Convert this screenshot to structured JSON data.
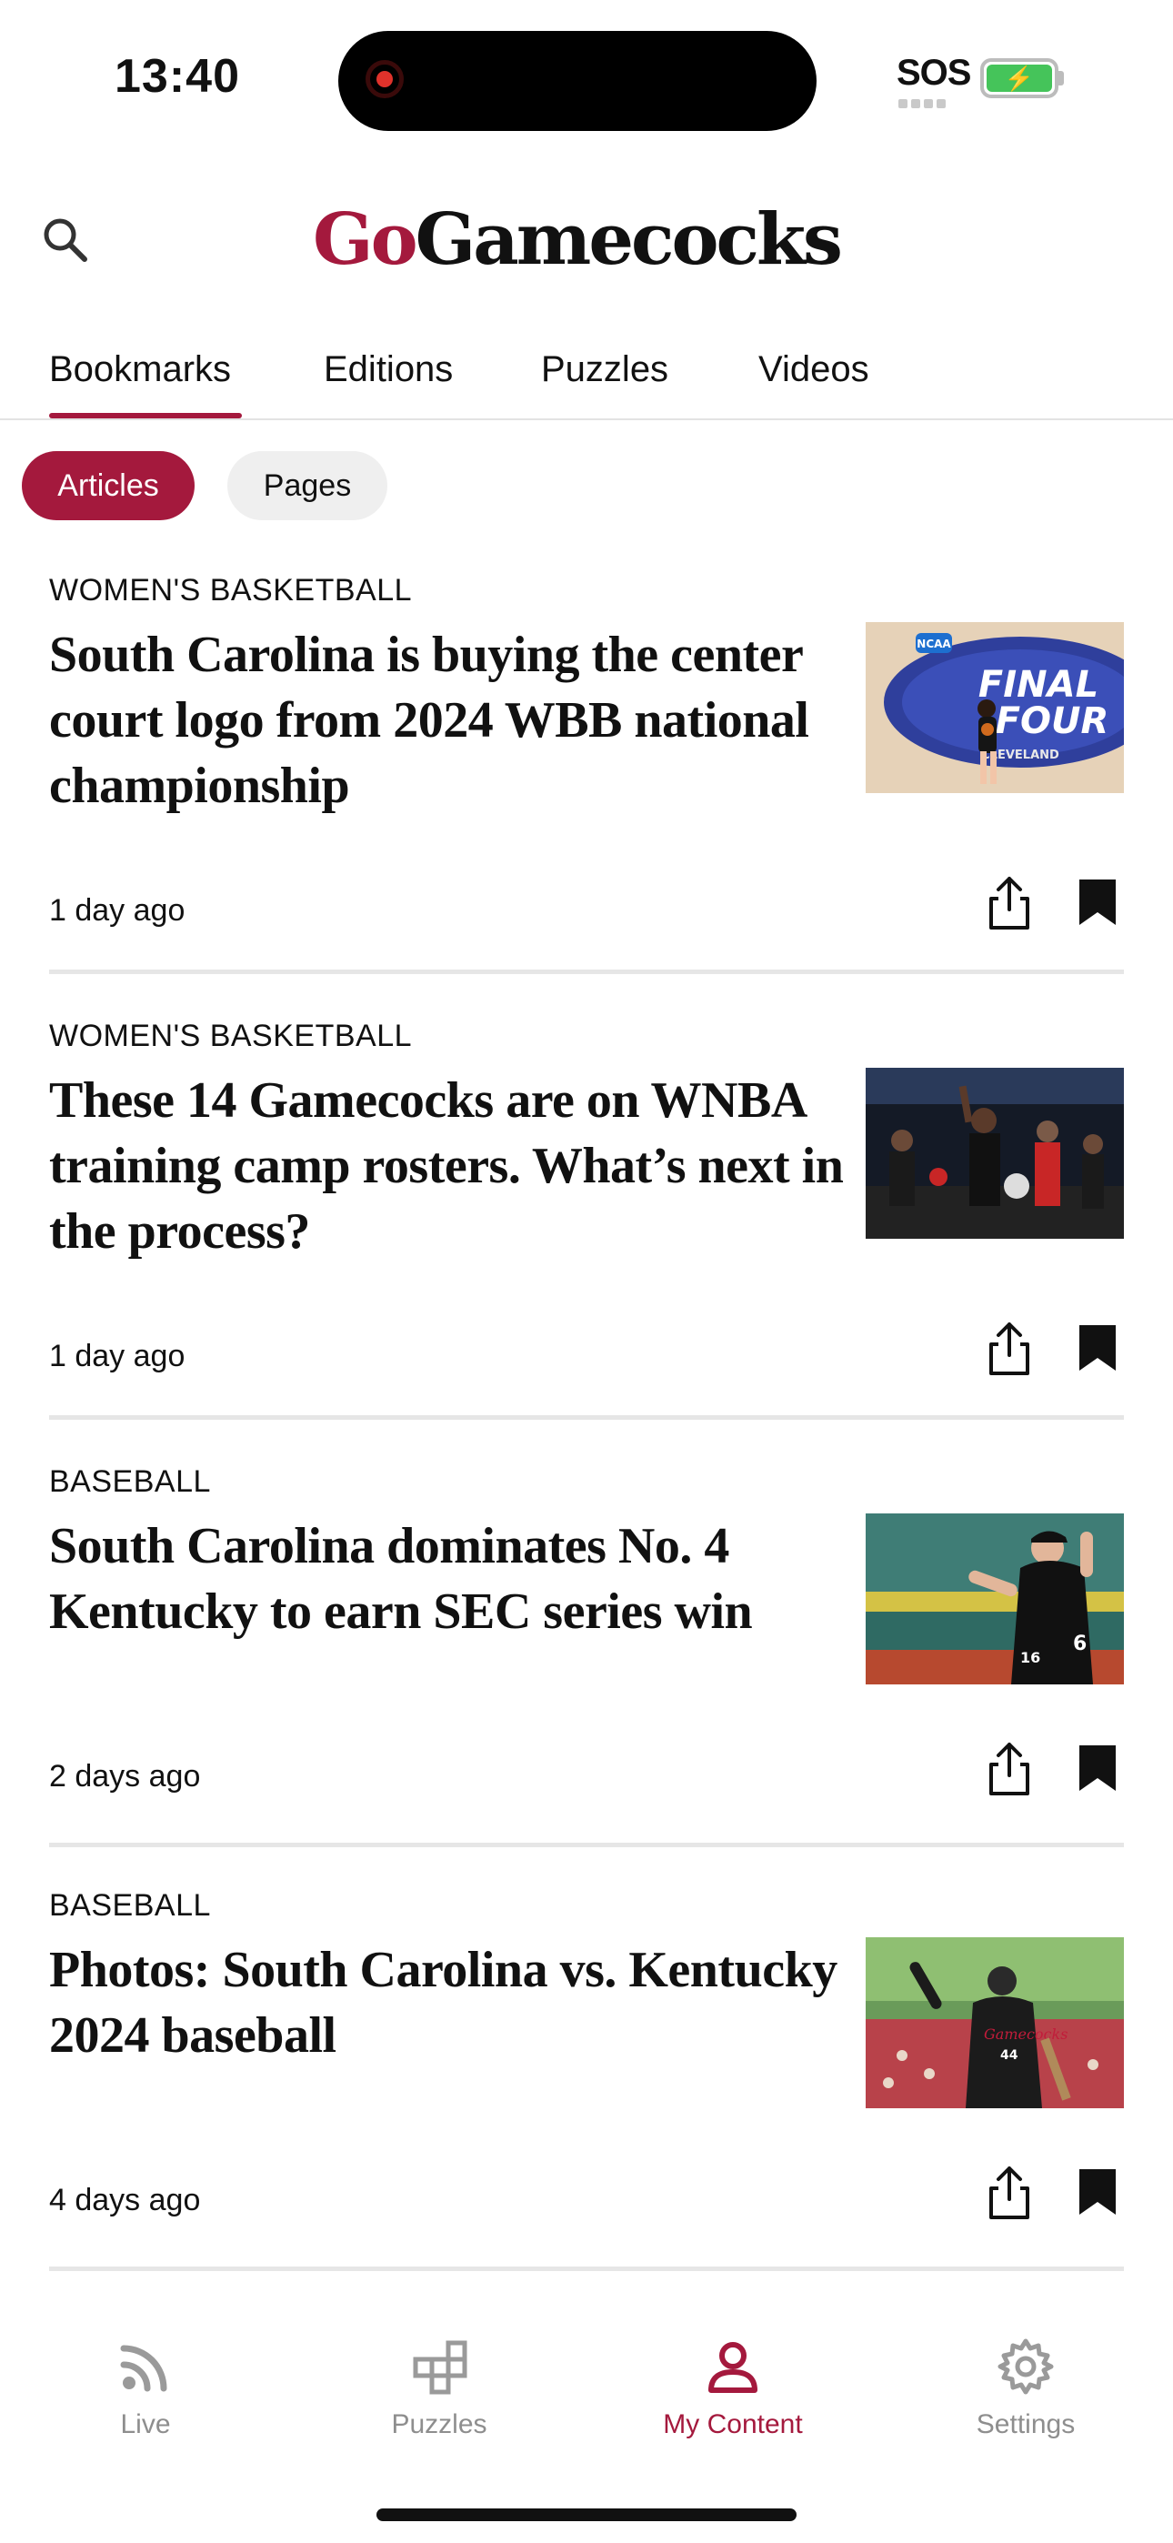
{
  "status_bar": {
    "time": "13:40",
    "sos": "SOS"
  },
  "header": {
    "logo_part1": "Go",
    "logo_part2": "Gamecocks"
  },
  "tabs": [
    {
      "label": "Bookmarks",
      "active": true
    },
    {
      "label": "Editions"
    },
    {
      "label": "Puzzles"
    },
    {
      "label": "Videos"
    }
  ],
  "chips": [
    {
      "label": "Articles",
      "active": true
    },
    {
      "label": "Pages"
    }
  ],
  "articles": [
    {
      "category": "WOMEN'S BASKETBALL",
      "headline": "South Carolina is buying the center court logo from 2024 WBB national championship",
      "time": "1 day ago"
    },
    {
      "category": "WOMEN'S BASKETBALL",
      "headline": "These 14 Gamecocks are on WNBA training camp rosters. What’s next in the process?",
      "time": "1 day ago"
    },
    {
      "category": "BASEBALL",
      "headline": "South Carolina dominates No. 4 Kentucky to earn SEC series win",
      "time": "2 days ago"
    },
    {
      "category": "BASEBALL",
      "headline": "Photos: South Carolina vs. Kentucky 2024 baseball",
      "time": "4 days ago"
    }
  ],
  "thumb_text": {
    "ncaa": "NCAA",
    "final": "FINAL",
    "four": "FOUR",
    "city": "CLEVELAND"
  },
  "bottom_nav": [
    {
      "label": "Live",
      "icon": "rss-icon"
    },
    {
      "label": "Puzzles",
      "icon": "puzzle-icon"
    },
    {
      "label": "My Content",
      "icon": "person-icon",
      "active": true
    },
    {
      "label": "Settings",
      "icon": "gear-icon"
    }
  ],
  "colors": {
    "brand": "#a4193d",
    "text": "#111111",
    "muted": "#8e8e8e"
  }
}
